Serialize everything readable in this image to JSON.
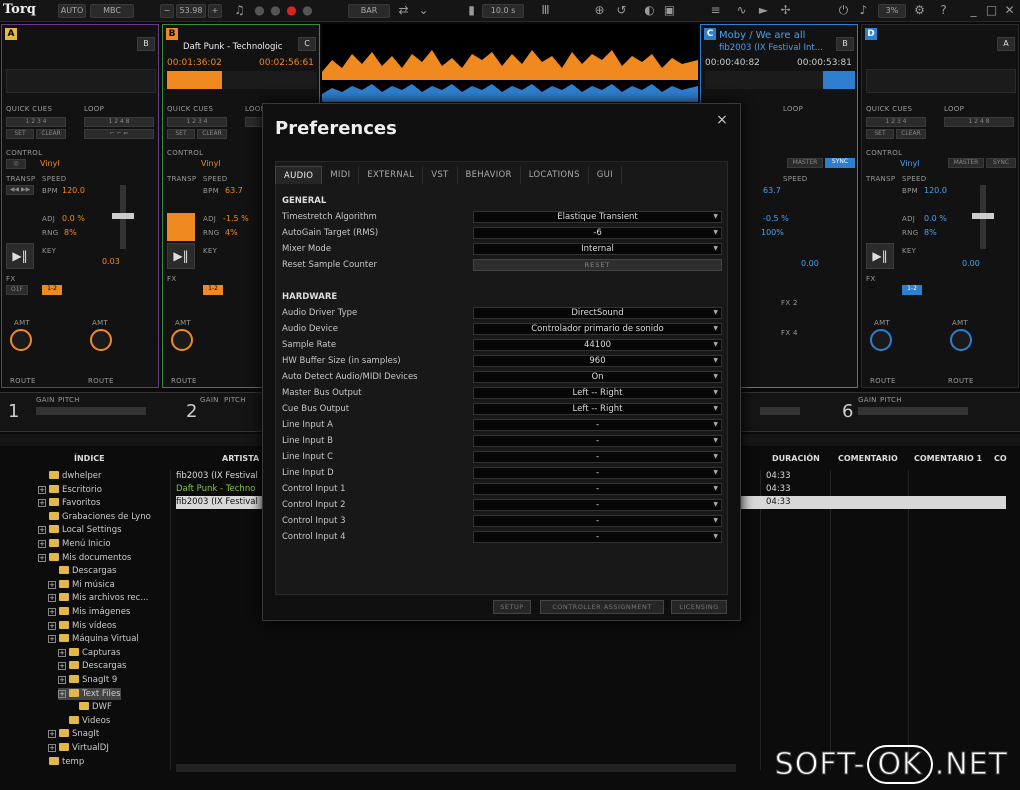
{
  "app": {
    "logo": "Torq",
    "auto": "AUTO",
    "mbc": "MBC",
    "bpm": "53.98",
    "bar": "BAR",
    "time": "10.0 s",
    "percent": "3%"
  },
  "decks": {
    "a": {
      "letter": "A",
      "key": "B"
    },
    "b": {
      "letter": "B",
      "title": "Daft Punk - Technologic",
      "elapsed": "00:01:36:02",
      "remain": "00:02:56:61",
      "key": "C",
      "bpm": "63.7",
      "adj": "-1.5 %",
      "rng": "4%",
      "vinyl": "Vinyl",
      "key_val": "0.03"
    },
    "c": {
      "letter": "C",
      "title": "Moby / We are all",
      "subtitle": "fib2003 (IX Festival Int...",
      "elapsed": "00:00:40:82",
      "remain": "00:00:53:81",
      "key": "B",
      "bpm": "63.7",
      "adj": "-0.5 %",
      "rng": "100%",
      "key_val": "0.00"
    },
    "d": {
      "letter": "D",
      "key": "A",
      "bpm": "120.0",
      "adj": "0.0 %",
      "rng": "8%",
      "vinyl": "Vinyl",
      "key_val": "0.00"
    },
    "a_detail": {
      "bpm": "120.0",
      "adj": "0.0 %",
      "rng": "8%",
      "vinyl": "Vinyl",
      "key_val": "0.03"
    }
  },
  "labels": {
    "quick_cues": "QUICK CUES",
    "loop": "LOOP",
    "control": "CONTROL",
    "transp": "TRANSP",
    "speed": "SPEED",
    "bpm": "BPM",
    "adj": "ADJ",
    "rng": "RNG",
    "key": "KEY",
    "fx": "FX",
    "amt": "AMT",
    "route": "ROUTE",
    "set": "SET",
    "clear": "CLEAR",
    "master": "MASTER",
    "sync": "SYNC",
    "fx2": "FX 2",
    "fx4": "FX 4",
    "gain": "GAIN",
    "pitch": "PITCH",
    "ch1": "1",
    "ch2": "2",
    "ch6": "6"
  },
  "browser": {
    "columns": {
      "indice": "ÍNDICE",
      "artista": "ARTISTA",
      "duracion": "DURACIÓN",
      "comentario": "COMENTARIO",
      "comentario1": "COMENTARIO 1",
      "co": "CO"
    },
    "tree": [
      {
        "label": "dwhelper",
        "indent": 0,
        "plus": false
      },
      {
        "label": "Escritorio",
        "indent": 0,
        "plus": true
      },
      {
        "label": "Favoritos",
        "indent": 0,
        "plus": true
      },
      {
        "label": "Grabaciones de Lyno",
        "indent": 0,
        "plus": false
      },
      {
        "label": "Local Settings",
        "indent": 0,
        "plus": true
      },
      {
        "label": "Menú Inicio",
        "indent": 0,
        "plus": true
      },
      {
        "label": "Mis documentos",
        "indent": 0,
        "plus": true
      },
      {
        "label": "Descargas",
        "indent": 1,
        "plus": false
      },
      {
        "label": "Mi música",
        "indent": 1,
        "plus": true
      },
      {
        "label": "Mis archivos rec...",
        "indent": 1,
        "plus": true
      },
      {
        "label": "Mis imágenes",
        "indent": 1,
        "plus": true
      },
      {
        "label": "Mis vídeos",
        "indent": 1,
        "plus": true
      },
      {
        "label": "Máquina Virtual",
        "indent": 1,
        "plus": true
      },
      {
        "label": "Capturas",
        "indent": 2,
        "plus": true
      },
      {
        "label": "Descargas",
        "indent": 2,
        "plus": true
      },
      {
        "label": "SnagIt 9",
        "indent": 2,
        "plus": true
      },
      {
        "label": "Text Files",
        "indent": 2,
        "plus": true
      },
      {
        "label": "DWF",
        "indent": 3,
        "plus": false
      },
      {
        "label": "Videos",
        "indent": 2,
        "plus": false
      },
      {
        "label": "SnagIt",
        "indent": 1,
        "plus": true
      },
      {
        "label": "VirtualDJ",
        "indent": 1,
        "plus": true
      },
      {
        "label": "temp",
        "indent": 0,
        "plus": false
      }
    ],
    "tracks": [
      {
        "artist": "fib2003 (IX Festival",
        "duration": "04:33"
      },
      {
        "artist": "Daft Punk - Techno",
        "duration": "04:33"
      },
      {
        "artist": "fib2003 (IX Festival",
        "duration": "04:33"
      }
    ]
  },
  "dialog": {
    "title": "Preferences",
    "close": "×",
    "tabs": [
      "AUDIO",
      "MIDI",
      "EXTERNAL",
      "VST",
      "BEHAVIOR",
      "LOCATIONS",
      "GUI"
    ],
    "general_header": "GENERAL",
    "general": [
      {
        "label": "Timestretch Algorithm",
        "value": "Elastique Transient"
      },
      {
        "label": "AutoGain Target (RMS)",
        "value": "-6"
      },
      {
        "label": "Mixer Mode",
        "value": "Internal"
      }
    ],
    "reset_label": "Reset Sample Counter",
    "reset_button": "RESET",
    "hardware_header": "HARDWARE",
    "hardware": [
      {
        "label": "Audio Driver Type",
        "value": "DirectSound"
      },
      {
        "label": "Audio Device",
        "value": "Controlador primario de sonido"
      },
      {
        "label": "Sample Rate",
        "value": "44100"
      },
      {
        "label": "HW Buffer Size (in samples)",
        "value": "960"
      },
      {
        "label": "Auto Detect Audio/MIDI Devices",
        "value": "On"
      },
      {
        "label": "Master Bus Output",
        "value": "Left -- Right"
      },
      {
        "label": "Cue Bus Output",
        "value": "Left -- Right"
      },
      {
        "label": "Line Input A",
        "value": "-"
      },
      {
        "label": "Line Input B",
        "value": "-"
      },
      {
        "label": "Line Input C",
        "value": "-"
      },
      {
        "label": "Line Input D",
        "value": "-"
      },
      {
        "label": "Control Input 1",
        "value": "-"
      },
      {
        "label": "Control Input 2",
        "value": "-"
      },
      {
        "label": "Control Input 3",
        "value": "-"
      },
      {
        "label": "Control Input 4",
        "value": "-"
      }
    ],
    "footer": {
      "setup": "SETUP",
      "controller": "CONTROLLER ASSIGNMENT",
      "licensing": "LICENSING"
    }
  },
  "watermark": {
    "left": "SOFT-",
    "box": "OK",
    "right": ".NET"
  },
  "colors": {
    "orange": "#f08a20",
    "blue": "#2f7fd0",
    "deck_a": "#6a3a8a",
    "deck_b": "#3a8a3a"
  }
}
